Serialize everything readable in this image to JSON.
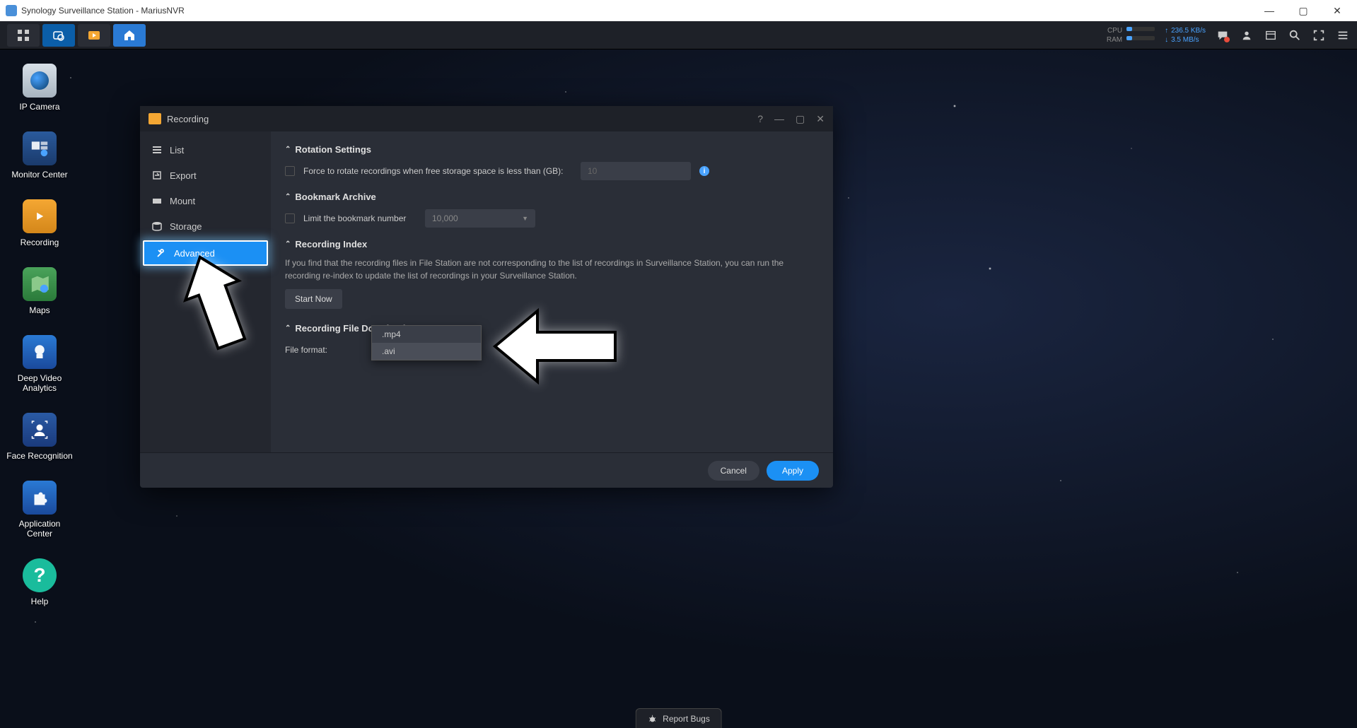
{
  "os_title": "Synology Surveillance Station - MariusNVR",
  "taskbar": {
    "cpu_label": "CPU",
    "ram_label": "RAM",
    "net_up": "236.5 KB/s",
    "net_down": "3.5 MB/s"
  },
  "desktop_icons": [
    {
      "label": "IP Camera"
    },
    {
      "label": "Monitor Center"
    },
    {
      "label": "Recording"
    },
    {
      "label": "Maps"
    },
    {
      "label": "Deep Video Analytics"
    },
    {
      "label": "Face Recognition"
    },
    {
      "label": "Application Center"
    },
    {
      "label": "Help"
    }
  ],
  "window": {
    "title": "Recording",
    "sidebar": [
      {
        "label": "List"
      },
      {
        "label": "Export"
      },
      {
        "label": "Mount"
      },
      {
        "label": "Storage"
      },
      {
        "label": "Advanced"
      }
    ],
    "sections": {
      "rotation": {
        "title": "Rotation Settings",
        "check_label": "Force to rotate recordings when free storage space is less than (GB):",
        "value": "10"
      },
      "bookmark": {
        "title": "Bookmark Archive",
        "check_label": "Limit the bookmark number",
        "value": "10,000"
      },
      "index": {
        "title": "Recording Index",
        "desc": "If you find that the recording files in File Station are not corresponding to the list of recordings in Surveillance Station, you can run the recording re-index to update the list of recordings in your Surveillance Station.",
        "button": "Start Now"
      },
      "format": {
        "title": "Recording File Download Format",
        "label": "File format:",
        "value": ".mp4",
        "options": [
          ".mp4",
          ".avi"
        ]
      }
    },
    "footer": {
      "cancel": "Cancel",
      "apply": "Apply"
    }
  },
  "report_bugs": "Report Bugs",
  "help_q": "?"
}
